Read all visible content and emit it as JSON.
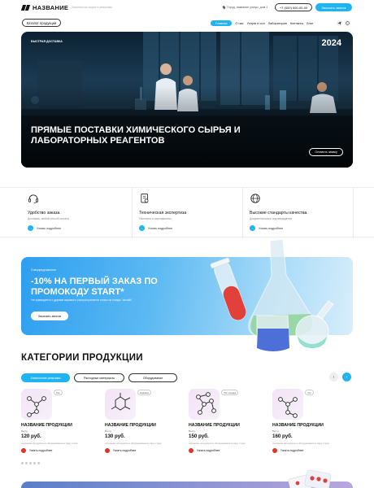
{
  "header": {
    "logo_text": "НАЗВАНИЕ",
    "tagline": "Химическое сырьё и реактивы",
    "address": "Город, название улицы, дом 1",
    "phone": "+7 (000) 000-00-00",
    "call_label": "Заказать звонок",
    "catalog_label": "Каталог продукции",
    "nav": [
      "Главная",
      "О нас",
      "Услуги и сол",
      "Лаборатория",
      "Контакты",
      "Блог"
    ]
  },
  "hero": {
    "tag": "БЫСТРАЯ ДОСТАВКА",
    "year": "2024",
    "title": "Прямые поставки химического сырья и лабораторных реагентов",
    "button": "Оставить заявку"
  },
  "features": [
    {
      "title": "Удобство заказа",
      "sub": "Доставка, любой способ оплаты",
      "more": "Узнать подробнее",
      "icon": "headset-icon"
    },
    {
      "title": "Техническая экспертиза",
      "sub": "Паспорта и сертификаты",
      "more": "Узнать подробнее",
      "icon": "certificate-icon"
    },
    {
      "title": "Высокие стандарты качества",
      "sub": "Документальные подтверждения",
      "more": "Узнать подробнее",
      "icon": "globe-icon"
    }
  ],
  "promo": {
    "small": "Спецпредложение",
    "title": "-10% на первый заказ по промокоду START*",
    "desc": "*не суммируется с другими акциями и распространяется только на товары \"онлайн\"",
    "button": "Заказать звонок"
  },
  "categories": {
    "title": "КАТЕГОРИИ ПРОДУКЦИИ",
    "tabs": [
      "Химические реактивы",
      "Расходные материалы",
      "Оборудование"
    ],
    "products": [
      {
        "name": "НАЗВАНИЕ ПРОДУКЦИИ",
        "badge": "Хит",
        "weight": "Вес/д",
        "price": "120 руб.",
        "desc": "описание продукции и оборудования в пару строк",
        "more": "Узнать подробнее"
      },
      {
        "name": "НАЗВАНИЕ ПРОДУКЦИИ",
        "badge": "Новинка",
        "weight": "Вес/д",
        "price": "130 руб.",
        "desc": "описание продукции и оборудования в пару строк",
        "more": "Узнать подробнее"
      },
      {
        "name": "НАЗВАНИЕ ПРОДУКЦИИ",
        "badge": "Хит продаж",
        "weight": "Вес/д",
        "price": "150 руб.",
        "desc": "описание продукции и оборудования в пару строк",
        "more": "Узнать подробнее"
      },
      {
        "name": "НАЗВАНИЕ ПРОДУКЦИИ",
        "badge": "Хит",
        "weight": "Вес/д",
        "price": "160 руб.",
        "desc": "описание продукции и оборудования в пару строк",
        "more": "Узнать подробнее"
      }
    ]
  },
  "colors": {
    "accent": "#1fb3f2",
    "danger": "#e0342b"
  }
}
